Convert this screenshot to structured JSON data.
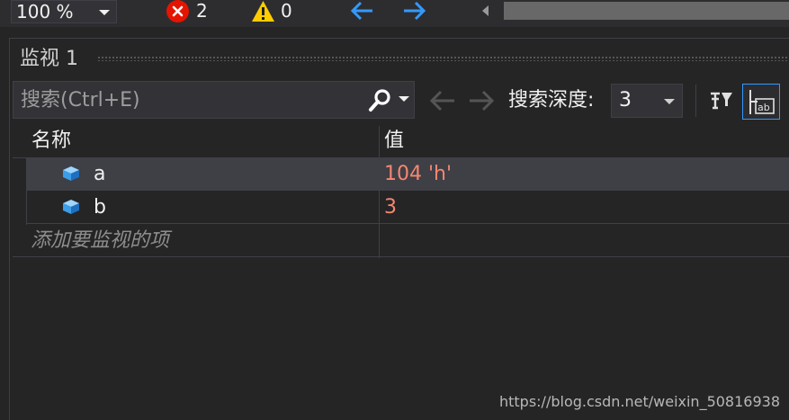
{
  "statusbar": {
    "zoom": "100 %",
    "error_count": "2",
    "warning_count": "0"
  },
  "panel": {
    "title": "监视 1"
  },
  "toolbar": {
    "search_placeholder": "搜索(Ctrl+E)",
    "depth_label": "搜索深度:",
    "depth_value": "3"
  },
  "grid": {
    "columns": [
      "名称",
      "值"
    ],
    "rows": [
      {
        "name": "a",
        "value": "104 'h'",
        "icon": "variable-icon"
      },
      {
        "name": "b",
        "value": "3",
        "icon": "variable-icon"
      }
    ],
    "add_item_text": "添加要监视的项"
  },
  "watermark": "https://blog.csdn.net/weixin_50816938",
  "colors": {
    "background": "#252526",
    "toolbar": "#2d2d30",
    "value_text": "#f48771",
    "accent": "#3399ff",
    "error": "#e51400",
    "warning": "#ffcc00"
  }
}
